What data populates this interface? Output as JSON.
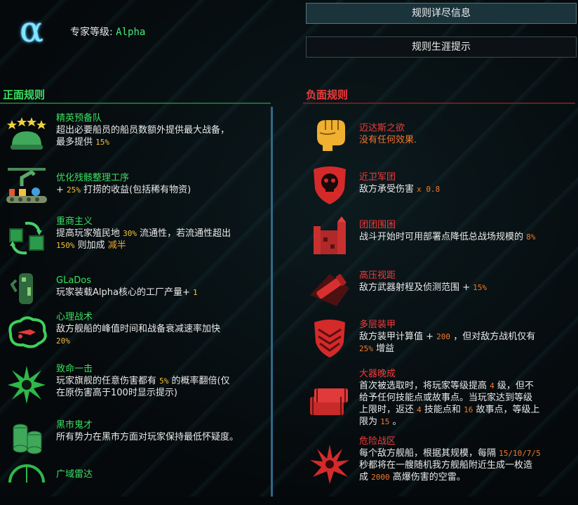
{
  "header": {
    "expert_label": "专家等级: ",
    "expert_level": "Alpha",
    "logo_glyph": "α",
    "btn_details": "规则详尽信息",
    "btn_tips": "规则生涯提示"
  },
  "positive": {
    "title": "正面规则",
    "rules": [
      {
        "name": "精英预备队",
        "d1": "超出必要船员的船员数额外提供最大战备，",
        "d2": "最多提供",
        "v1": "15%",
        "icon": "soldier-helmet-icon"
      },
      {
        "name": "优化残骸整理工序",
        "d1": "+",
        "v1": "25%",
        "d2": "打捞的收益(包括稀有物资)",
        "icon": "salvage-conveyor-icon"
      },
      {
        "name": "重商主义",
        "d1": "提高玩家殖民地",
        "v1": "30%",
        "d2": "流通性，若流通性超出",
        "v2": "150%",
        "d3": "则加成",
        "d4": "减半",
        "icon": "trade-crates-icon"
      },
      {
        "name": "GLaDos",
        "d1": "玩家装载Alpha核心的工厂产量+",
        "v1": "1",
        "icon": "robot-arm-icon"
      },
      {
        "name": "心理战术",
        "d1": "敌方舰船的峰值时间和战备衰减速率加快",
        "v1": "20%",
        "icon": "brain-icon"
      },
      {
        "name": "致命一击",
        "d1": "玩家旗舰的任意伤害都有",
        "v1": "5%",
        "d2": "的概率翻倍(仅",
        "d3": "在原伤害高于100时显示提示)",
        "icon": "explosion-burst-icon"
      },
      {
        "name": "黑市鬼才",
        "d1": "所有势力在黑市方面对玩家保持最低怀疑度。",
        "icon": "coin-stacks-icon"
      },
      {
        "name": "广域雷达",
        "icon": "radar-icon"
      }
    ]
  },
  "negative": {
    "title": "负面规则",
    "rules": [
      {
        "name": "迈达斯之欲",
        "d1": "没有任何效果.",
        "icon": "golden-fist-icon"
      },
      {
        "name": "近卫军团",
        "d1": "敌方承受伤害",
        "v1": "x 0.8",
        "icon": "skull-shield-icon"
      },
      {
        "name": "团团围困",
        "d1": "战斗开始时可用部署点降低总战场规模的",
        "v1": "8%",
        "icon": "castle-siege-icon"
      },
      {
        "name": "高压视距",
        "d1": "敌方武器射程及侦测范围 +",
        "v1": "15%",
        "icon": "telescope-icon"
      },
      {
        "name": "多层装甲",
        "d1": "敌方装甲计算值 +",
        "v1": "200",
        "d2": "，但对敌方战机仅有",
        "v2": "25%",
        "d3": "增益",
        "icon": "armor-plates-icon"
      },
      {
        "name": "大器晚成",
        "d1": "首次被选取时，将玩家等级提高",
        "v1": "4",
        "d2": "级，但不",
        "d3": "给予任何技能点或故事点。当玩家达到等级",
        "d4": "上限时，返还",
        "v2": "4",
        "d5": "技能点和",
        "v3": "16",
        "d6": "故事点，等级上",
        "d7": "限为",
        "v4": "15",
        "d8": "。",
        "icon": "ammo-crates-icon"
      },
      {
        "name": "危险战区",
        "d1": "每个敌方舰船，根据其规模，每隔",
        "v1": "15/10/7/5",
        "d2": "秒都将在一艘随机我方舰船附近生成一枚造",
        "d3": "成",
        "v2": "2000",
        "d4": "高爆伤害的空雷。",
        "icon": "mine-explosion-icon"
      }
    ]
  },
  "colors": {
    "positive": "#39e05f",
    "negative": "#f23b3b",
    "value": "#f3c136",
    "value_neg": "#f27a2c",
    "accent": "#7fe6ff"
  }
}
